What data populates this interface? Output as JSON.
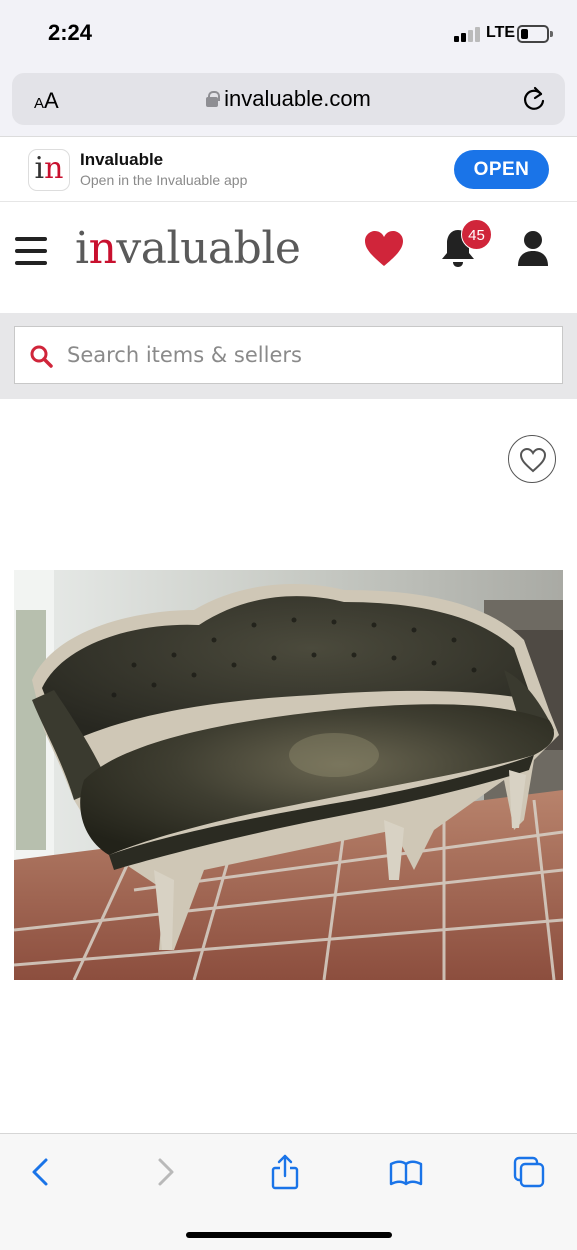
{
  "status_bar": {
    "time": "2:24",
    "network": "LTE",
    "battery_level": 0.3
  },
  "browser": {
    "text_size_label": "AA",
    "url": "invaluable.com"
  },
  "app_banner": {
    "app_name": "Invaluable",
    "subtitle": "Open in the Invaluable app",
    "open_label": "OPEN",
    "accent_color": "#1a74e8"
  },
  "header": {
    "logo_first": "i",
    "logo_accent": "n",
    "logo_rest": "valuable",
    "notification_count": "45",
    "brand_color": "#c8102e"
  },
  "search": {
    "placeholder": "Search items & sellers"
  },
  "lot": {
    "image_description_icon": "sofa-photo",
    "favorite_icon": "heart-outline-icon"
  },
  "toolbar": {
    "icons": [
      "back-icon",
      "forward-icon",
      "share-icon",
      "bookmarks-icon",
      "tabs-icon"
    ]
  }
}
